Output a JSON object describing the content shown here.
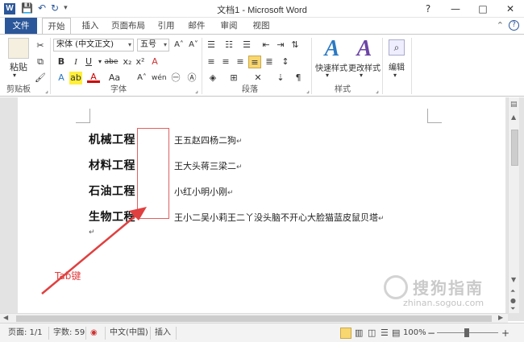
{
  "window": {
    "title": "文档1 - Microsoft Word",
    "logo": "W",
    "controls": {
      "help": "?",
      "restore": "▭",
      "minimize": "—",
      "maximize": "□",
      "close": "✕"
    }
  },
  "tabs": [
    "文件",
    "开始",
    "插入",
    "页面布局",
    "引用",
    "邮件",
    "审阅",
    "视图"
  ],
  "ribbon": {
    "clipboard": {
      "label": "剪贴板",
      "paste": "粘贴"
    },
    "font": {
      "label": "字体",
      "font_name": "宋体 (中文正文)",
      "font_size": "五号",
      "bold": "B",
      "italic": "I",
      "underline": "U",
      "strike": "abe",
      "sub": "x₂",
      "sup": "x²",
      "clear": "A",
      "color": "A",
      "grow": "A˄",
      "shrink": "A˅",
      "aa": "Aa",
      "phonetic": "wén"
    },
    "paragraph": {
      "label": "段落"
    },
    "styles": {
      "label": "样式",
      "quick": "快速样式",
      "change": "更改样式"
    },
    "editing": {
      "label": "编辑"
    }
  },
  "document": {
    "rows": [
      {
        "left": "机械工程",
        "right": "王五赵四杨二狗"
      },
      {
        "left": "材料工程",
        "right": "王大头蒋三梁二"
      },
      {
        "left": "石油工程",
        "right": "小红小明小刚"
      },
      {
        "left": "生物工程",
        "right": "王小二吴小莉王二丫没头脑不开心大脸猫蓝皮鼠贝塔"
      }
    ],
    "para_mark": "↵",
    "annotation": "Tab键"
  },
  "watermark": {
    "main": "搜狗指南",
    "url": "zhinan.sogou.com"
  },
  "statusbar": {
    "page": "页面: 1/1",
    "words": "字数: 59",
    "language": "中文(中国)",
    "mode": "插入",
    "zoom": "100%",
    "zoom_minus": "−",
    "zoom_plus": "+"
  },
  "colors": {
    "accent": "#2b579a",
    "annotation": "#e04040"
  }
}
